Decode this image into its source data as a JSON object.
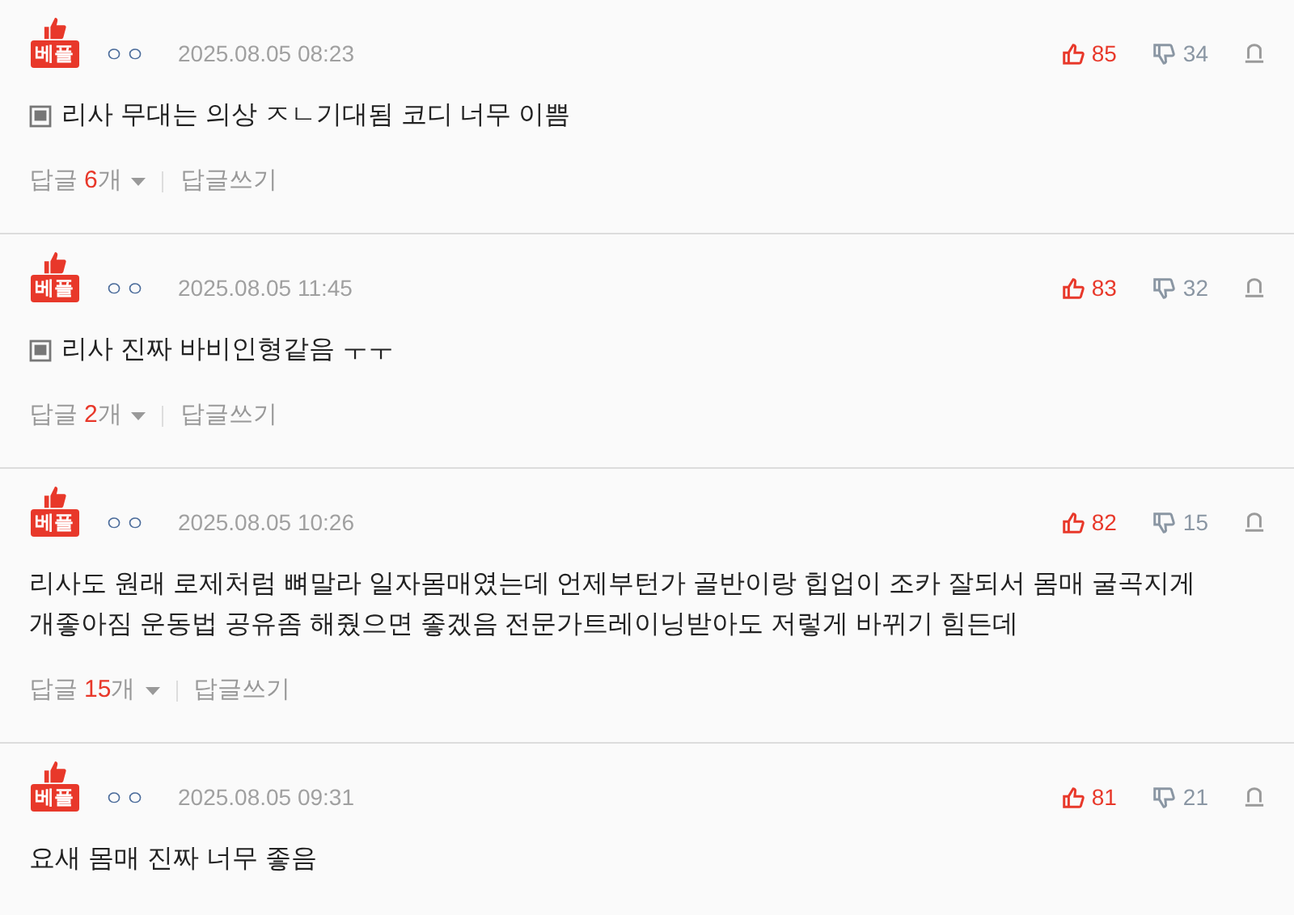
{
  "comments": [
    {
      "badge": "베플",
      "author": "ㅇㅇ",
      "date": "2025.08.05 08:23",
      "likes": "85",
      "dislikes": "34",
      "has_image": true,
      "text": "리사 무대는 의상 ㅈㄴ기대됨 코디 너무 이쁨",
      "reply_label": "답글",
      "reply_count": "6",
      "reply_unit": "개",
      "write_reply": "답글쓰기"
    },
    {
      "badge": "베플",
      "author": "ㅇㅇ",
      "date": "2025.08.05 11:45",
      "likes": "83",
      "dislikes": "32",
      "has_image": true,
      "text": "리사 진짜 바비인형같음 ㅜㅜ",
      "reply_label": "답글",
      "reply_count": "2",
      "reply_unit": "개",
      "write_reply": "답글쓰기"
    },
    {
      "badge": "베플",
      "author": "ㅇㅇ",
      "date": "2025.08.05 10:26",
      "likes": "82",
      "dislikes": "15",
      "has_image": false,
      "text": "리사도 원래 로제처럼 뼈말라 일자몸매였는데 언제부턴가 골반이랑 힙업이 조카 잘되서 몸매 굴곡지게 개좋아짐 운동법 공유좀 해줬으면 좋겠음 전문가트레이닝받아도 저렇게 바뀌기 힘든데",
      "reply_label": "답글",
      "reply_count": "15",
      "reply_unit": "개",
      "write_reply": "답글쓰기"
    },
    {
      "badge": "베플",
      "author": "ㅇㅇ",
      "date": "2025.08.05 09:31",
      "likes": "81",
      "dislikes": "21",
      "has_image": false,
      "text": "요새 몸매 진짜 너무 좋음"
    }
  ]
}
